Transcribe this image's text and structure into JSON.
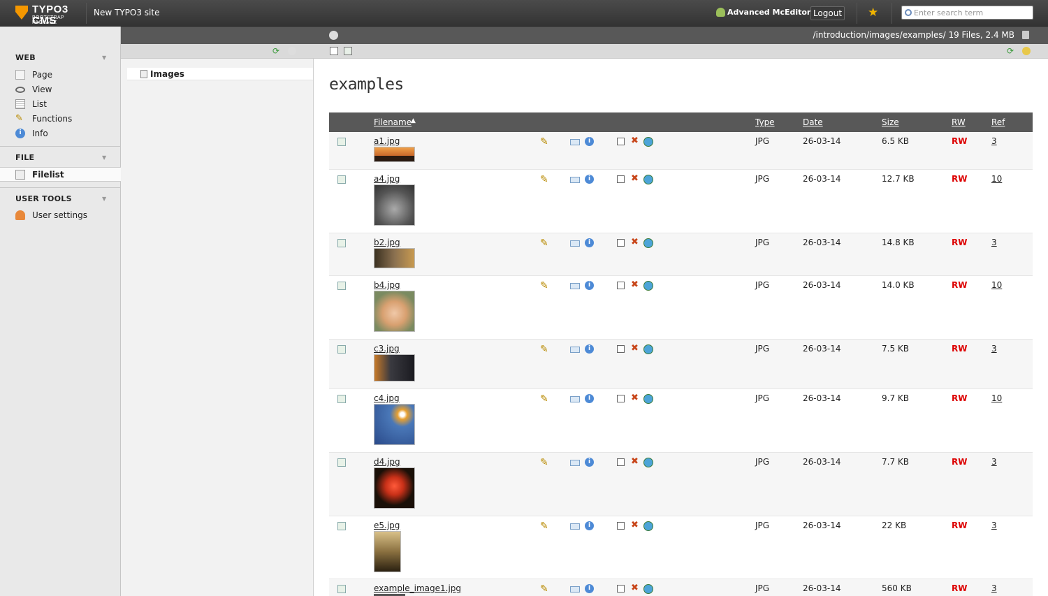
{
  "topbar": {
    "logo_text": "TYPO3 CMS",
    "logo_sub": "BOOTSTRAP PACKAGE",
    "site_name": "New TYPO3 site",
    "user_name": "Advanced McEditor",
    "logout_label": "Logout",
    "search_placeholder": "Enter search term"
  },
  "modules": {
    "web": {
      "label": "WEB",
      "items": [
        "Page",
        "View",
        "List",
        "Functions",
        "Info"
      ]
    },
    "file": {
      "label": "FILE",
      "items": [
        "Filelist"
      ]
    },
    "user_tools": {
      "label": "USER TOOLS",
      "items": [
        "User settings"
      ]
    }
  },
  "docheader": {
    "path": "/introduction/images/examples/ 19 Files, 2.4 MB"
  },
  "tree": {
    "node": "Images"
  },
  "content": {
    "heading": "examples",
    "columns": {
      "filename": "Filename",
      "sort_arrow": "▲",
      "type": "Type",
      "date": "Date",
      "size": "Size",
      "rw": "RW",
      "ref": "Ref"
    },
    "files": [
      {
        "name": "a1.jpg",
        "type": "JPG",
        "date": "26-03-14",
        "size": "6.5 KB",
        "rw": "RW",
        "ref": "3"
      },
      {
        "name": "a4.jpg",
        "type": "JPG",
        "date": "26-03-14",
        "size": "12.7 KB",
        "rw": "RW",
        "ref": "10"
      },
      {
        "name": "b2.jpg",
        "type": "JPG",
        "date": "26-03-14",
        "size": "14.8 KB",
        "rw": "RW",
        "ref": "3"
      },
      {
        "name": "b4.jpg",
        "type": "JPG",
        "date": "26-03-14",
        "size": "14.0 KB",
        "rw": "RW",
        "ref": "10"
      },
      {
        "name": "c3.jpg",
        "type": "JPG",
        "date": "26-03-14",
        "size": "7.5 KB",
        "rw": "RW",
        "ref": "3"
      },
      {
        "name": "c4.jpg",
        "type": "JPG",
        "date": "26-03-14",
        "size": "9.7 KB",
        "rw": "RW",
        "ref": "10"
      },
      {
        "name": "d4.jpg",
        "type": "JPG",
        "date": "26-03-14",
        "size": "7.7 KB",
        "rw": "RW",
        "ref": "3"
      },
      {
        "name": "e5.jpg",
        "type": "JPG",
        "date": "26-03-14",
        "size": "22 KB",
        "rw": "RW",
        "ref": "3"
      },
      {
        "name": "example_image1.jpg",
        "type": "JPG",
        "date": "26-03-14",
        "size": "560 KB",
        "rw": "RW",
        "ref": "3"
      }
    ]
  },
  "colors": {
    "accent": "#f49700",
    "rw_red": "#dd0000",
    "header_dark": "#585858"
  }
}
